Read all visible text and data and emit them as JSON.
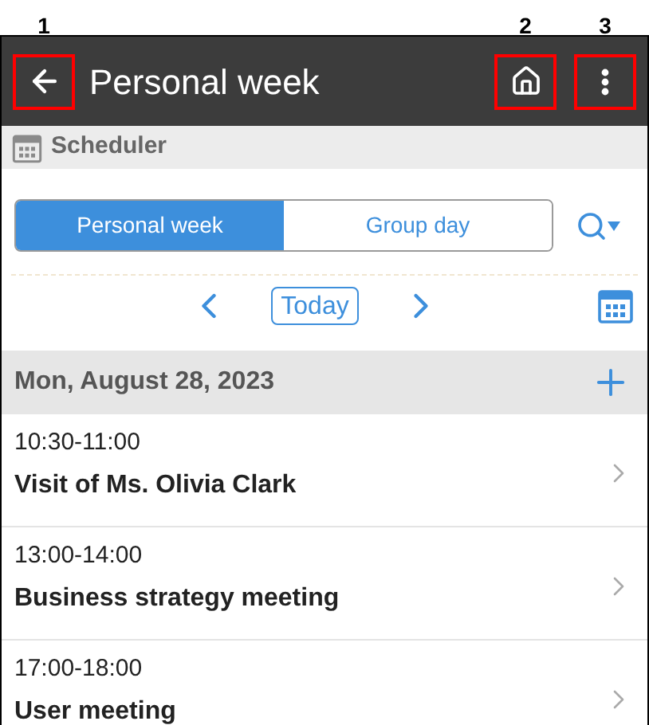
{
  "header": {
    "back": {
      "callout": "1"
    },
    "title": "Personal week",
    "actions": [
      {
        "kind": "home",
        "callout": "2"
      },
      {
        "kind": "menu",
        "callout": "3"
      }
    ]
  },
  "section": {
    "title": "Scheduler"
  },
  "tabs": [
    {
      "label": "Personal week",
      "selected": true
    },
    {
      "label": "Group day",
      "selected": false
    }
  ],
  "nav": {
    "today": "Today"
  },
  "date_header": "Mon, August 28, 2023",
  "events": [
    {
      "time": "10:30-11:00",
      "title": "Visit of Ms. Olivia Clark"
    },
    {
      "time": "13:00-14:00",
      "title": "Business strategy meeting"
    },
    {
      "time": "17:00-18:00",
      "title": "User meeting"
    }
  ]
}
